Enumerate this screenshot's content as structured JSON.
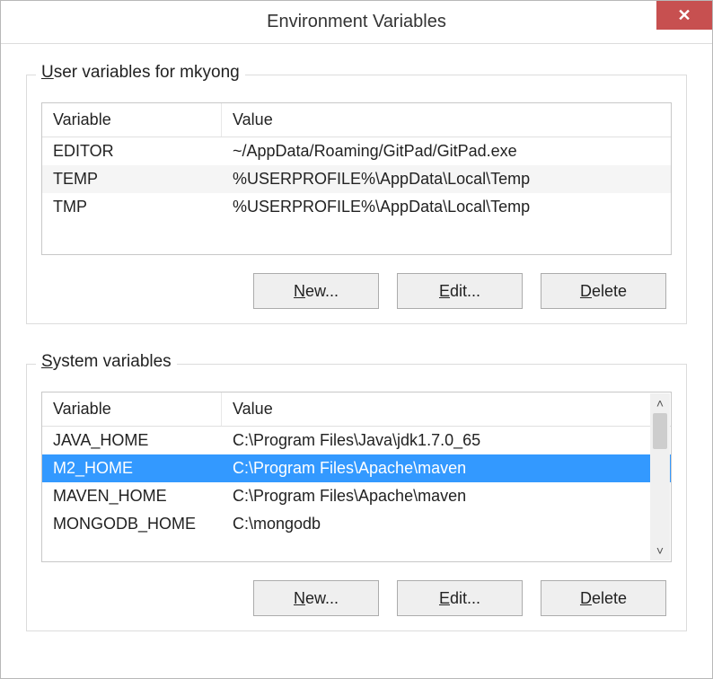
{
  "window": {
    "title": "Environment Variables",
    "close_glyph": "✕"
  },
  "user_group": {
    "label_prefix_ul": "U",
    "label_rest": "ser variables for mkyong",
    "header_variable": "Variable",
    "header_value": "Value",
    "rows": [
      {
        "variable": "EDITOR",
        "value": "~/AppData/Roaming/GitPad/GitPad.exe"
      },
      {
        "variable": "TEMP",
        "value": "%USERPROFILE%\\AppData\\Local\\Temp"
      },
      {
        "variable": "TMP",
        "value": "%USERPROFILE%\\AppData\\Local\\Temp"
      }
    ]
  },
  "system_group": {
    "label_prefix_ul": "S",
    "label_rest": "ystem variables",
    "header_variable": "Variable",
    "header_value": "Value",
    "rows": [
      {
        "variable": "JAVA_HOME",
        "value": "C:\\Program Files\\Java\\jdk1.7.0_65",
        "selected": false
      },
      {
        "variable": "M2_HOME",
        "value": "C:\\Program Files\\Apache\\maven",
        "selected": true
      },
      {
        "variable": "MAVEN_HOME",
        "value": "C:\\Program Files\\Apache\\maven",
        "selected": false
      },
      {
        "variable": "MONGODB_HOME",
        "value": "C:\\mongodb",
        "selected": false
      }
    ]
  },
  "buttons": {
    "new_ul": "N",
    "new_rest": "ew...",
    "edit_ul": "E",
    "edit_rest": "dit...",
    "delete_ul": "D",
    "delete_rest": "elete"
  },
  "scroll": {
    "up": "˄",
    "down": "˅"
  }
}
